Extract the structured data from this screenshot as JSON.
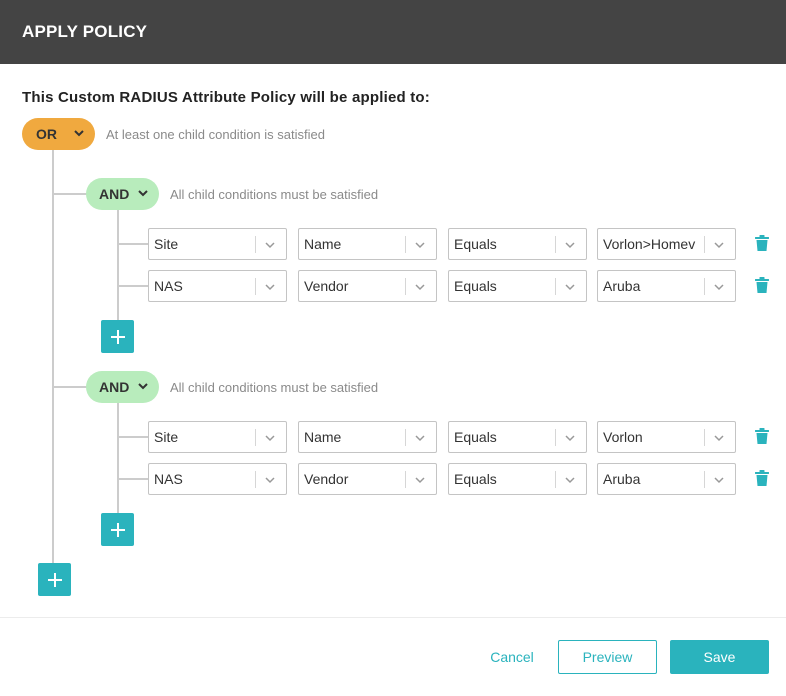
{
  "header": {
    "title": "APPLY POLICY"
  },
  "subtitle": "This Custom RADIUS Attribute Policy will be applied to:",
  "root": {
    "operator": "OR",
    "hint": "At least one child condition is satisfied",
    "groups": [
      {
        "operator": "AND",
        "hint": "All child conditions must be satisfied",
        "conditions": [
          {
            "category": "Site",
            "attribute": "Name",
            "operator": "Equals",
            "value": "Vorlon>Homev"
          },
          {
            "category": "NAS",
            "attribute": "Vendor",
            "operator": "Equals",
            "value": "Aruba"
          }
        ]
      },
      {
        "operator": "AND",
        "hint": "All child conditions must be satisfied",
        "conditions": [
          {
            "category": "Site",
            "attribute": "Name",
            "operator": "Equals",
            "value": "Vorlon"
          },
          {
            "category": "NAS",
            "attribute": "Vendor",
            "operator": "Equals",
            "value": "Aruba"
          }
        ]
      }
    ]
  },
  "icons": {
    "dropdown": "chevron-down-icon",
    "delete": "trash-icon",
    "add": "plus-icon"
  },
  "colors": {
    "header_bg": "#444444",
    "or_pill": "#f0a93f",
    "and_pill": "#b8ecbc",
    "accent": "#2ab3bd"
  },
  "footer": {
    "cancel_label": "Cancel",
    "preview_label": "Preview",
    "save_label": "Save"
  }
}
